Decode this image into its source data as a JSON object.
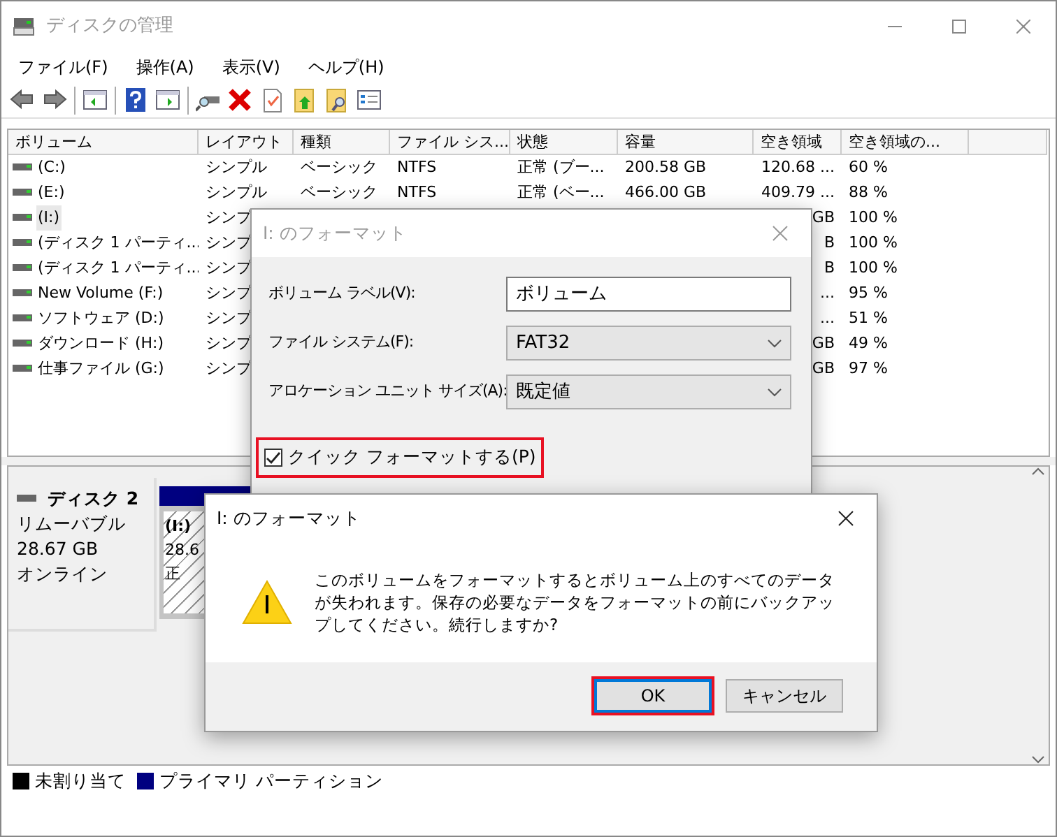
{
  "window": {
    "title": "ディスクの管理"
  },
  "menu": [
    "ファイル(F)",
    "操作(A)",
    "表示(V)",
    "ヘルプ(H)"
  ],
  "table": {
    "columns": [
      "ボリューム",
      "レイアウト",
      "種類",
      "ファイル シス...",
      "状態",
      "容量",
      "空き領域",
      "空き領域の..."
    ],
    "rows": [
      {
        "volume": "(C:)",
        "layout": "シンプル",
        "type": "ベーシック",
        "fs": "NTFS",
        "status": "正常 (ブー...",
        "capacity": "200.58 GB",
        "free": "120.68 ...",
        "free_pct": "60 %",
        "selected": false
      },
      {
        "volume": "(E:)",
        "layout": "シンプル",
        "type": "ベーシック",
        "fs": "NTFS",
        "status": "正常 (ベー...",
        "capacity": "466.00 GB",
        "free": "409.79 ...",
        "free_pct": "88 %",
        "selected": false
      },
      {
        "volume": "(I:)",
        "layout": "シンプ",
        "free": "GB",
        "free_pct": "100 %",
        "selected": true
      },
      {
        "volume": "(ディスク 1 パーティ...",
        "layout": "シンプ",
        "free": "B",
        "free_pct": "100 %",
        "selected": false
      },
      {
        "volume": "(ディスク 1 パーティ...",
        "layout": "シンプ",
        "free": "B",
        "free_pct": "100 %",
        "selected": false
      },
      {
        "volume": "New Volume (F:)",
        "layout": "シンプ",
        "free": "...",
        "free_pct": "95 %",
        "selected": false
      },
      {
        "volume": "ソフトウェア (D:)",
        "layout": "シンプ",
        "free": "...",
        "free_pct": "51 %",
        "selected": false
      },
      {
        "volume": "ダウンロード (H:)",
        "layout": "シンプ",
        "free": "GB",
        "free_pct": "49 %",
        "selected": false
      },
      {
        "volume": "仕事ファイル (G:)",
        "layout": "シンプ",
        "free": "GB",
        "free_pct": "97 %",
        "selected": false
      }
    ]
  },
  "disk": {
    "name": "ディスク 2",
    "type": "リムーバブル",
    "size": "28.67 GB",
    "state": "オンライン",
    "partition": {
      "label": "(I:)",
      "size": "28.6",
      "status": "正",
      "color": "#000080"
    }
  },
  "legend": [
    {
      "label": "未割り当て",
      "color": "#000000"
    },
    {
      "label": "プライマリ パーティション",
      "color": "#000080"
    }
  ],
  "format_dialog": {
    "title": "I: のフォーマット",
    "active": false,
    "fields": [
      {
        "kind": "text",
        "label": "ボリューム ラベル(V):",
        "value": "ボリューム"
      },
      {
        "kind": "select",
        "label": "ファイル システム(F):",
        "value": "FAT32"
      },
      {
        "kind": "select",
        "label": "アロケーション ユニット サイズ(A):",
        "value": "既定値"
      }
    ],
    "quick_format": {
      "label": "クイック フォーマットする(P)",
      "checked": true,
      "highlighted": true
    }
  },
  "confirm_dialog": {
    "title": "I: のフォーマット",
    "active": true,
    "message": "このボリュームをフォーマットするとボリューム上のすべてのデータが失われます。保存の必要なデータをフォーマットの前にバックアップしてください。続行しますか?",
    "buttons": [
      {
        "label": "OK",
        "focused": true,
        "highlighted": true
      },
      {
        "label": "キャンセル",
        "focused": false,
        "highlighted": false
      }
    ]
  }
}
